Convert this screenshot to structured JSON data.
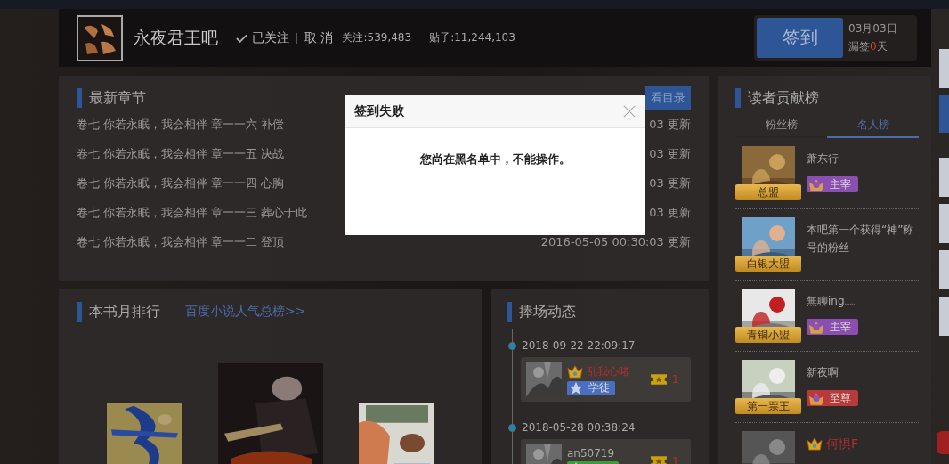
{
  "header": {
    "forum_name": "永夜君王吧",
    "follow_status": "已关注",
    "cancel": "取 消",
    "followers": "关注:539,483",
    "posts": "贴子:11,244,103"
  },
  "sign_in": {
    "button": "签到",
    "date": "03月03日",
    "missed_label": "漏签",
    "missed_count": "0",
    "missed_unit": "天"
  },
  "chapters": {
    "title": "最新章节",
    "catalog_button": "看目录",
    "rows": [
      {
        "title": "卷七 你若永眠，我会相伴 章一一六 补偿",
        "time": "03 更新"
      },
      {
        "title": "卷七 你若永眠，我会相伴 章一一五 决战",
        "time": "03 更新"
      },
      {
        "title": "卷七 你若永眠，我会相伴 章一一四 心胸",
        "time": "03 更新"
      },
      {
        "title": "卷七 你若永眠，我会相伴 章一一三 葬心于此",
        "time": "03 更新"
      },
      {
        "title": "卷七 你若永眠，我会相伴 章一一二 登顶",
        "time": "2016-05-05 00:30:03 更新"
      }
    ]
  },
  "ranking": {
    "title": "本书月排行",
    "link": "百度小说人气总榜>>"
  },
  "activity": {
    "title": "捧场动态",
    "entries": [
      {
        "time": "2018-09-22 22:09:17",
        "name": "乱我心啫",
        "vip": true,
        "badge": {
          "label": "学徒",
          "color": "#4a6fc0"
        },
        "tickets": "1"
      },
      {
        "time": "2018-05-28 00:38:24",
        "name": "an50719",
        "vip": false,
        "badge": {
          "color": "#3f9a3a"
        },
        "tickets": "1"
      }
    ]
  },
  "contributors": {
    "title": "读者贡献榜",
    "tabs": [
      {
        "label": "粉丝榜",
        "selected": false
      },
      {
        "label": "名人榜",
        "selected": true
      }
    ],
    "items": [
      {
        "rank": "总盟",
        "name": "萧东行",
        "vip": false,
        "badge": {
          "label": "主宰",
          "color": "#8a4fb0"
        }
      },
      {
        "rank": "白银大盟",
        "name": "本吧第一个获得“神”称号的粉丝",
        "vip": false
      },
      {
        "rank": "青铜小盟",
        "name": "無聊ing﹏",
        "vip": false,
        "badge": {
          "label": "主宰",
          "color": "#8a4fb0"
        }
      },
      {
        "rank": "第一票王",
        "name": "新夜啊",
        "vip": false,
        "badge": {
          "label": "至尊",
          "color": "#b83a3a"
        }
      },
      {
        "name": "何惧F",
        "vip": true
      }
    ]
  },
  "dialog": {
    "title": "签到失败",
    "message": "您尚在黑名单中，不能操作。"
  }
}
